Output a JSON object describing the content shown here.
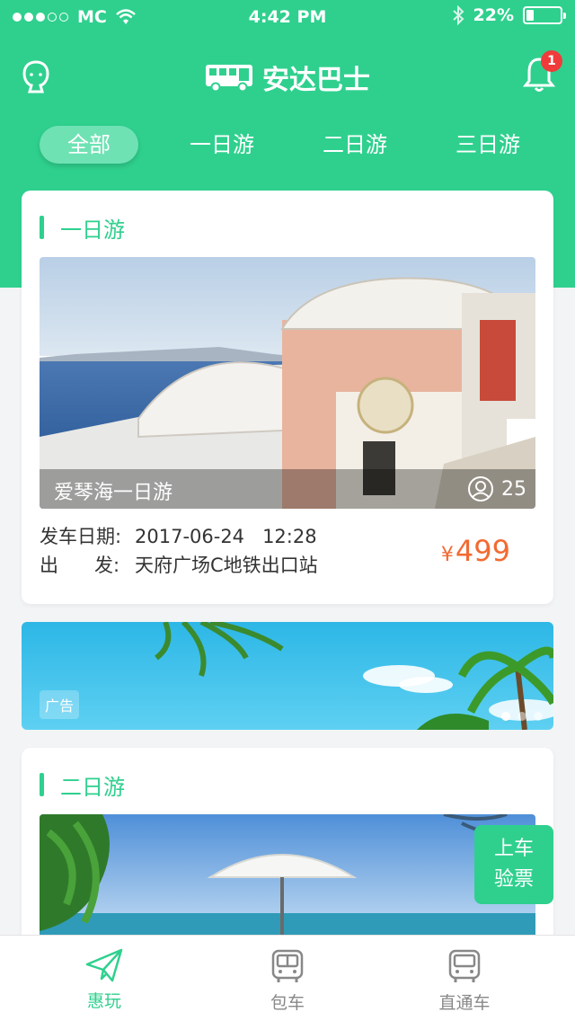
{
  "status_bar": {
    "carrier": "MC",
    "time": "4:42 PM",
    "battery": "22%",
    "battery_level": 0.22
  },
  "header": {
    "title": "安达巴士",
    "notification_count": "1"
  },
  "tabs": [
    {
      "label": "全部",
      "active": true
    },
    {
      "label": "一日游",
      "active": false
    },
    {
      "label": "二日游",
      "active": false
    },
    {
      "label": "三日游",
      "active": false
    }
  ],
  "trips": [
    {
      "section_title": "一日游",
      "trip_name": "爱琴海一日游",
      "passenger_count": "25",
      "date_label": "发车日期:",
      "date_value": "2017-06-24   12:28",
      "depart_label": "出      发:",
      "depart_value": "天府广场C地铁出口站",
      "currency": "¥",
      "price": "499"
    },
    {
      "section_title": "二日游"
    }
  ],
  "ad": {
    "tag": "广告",
    "dots_total": 3,
    "dots_active": 1
  },
  "check_button": {
    "line1": "上车",
    "line2": "验票"
  },
  "bottom_nav": [
    {
      "label": "惠玩",
      "icon": "paper-plane-icon",
      "active": true
    },
    {
      "label": "包车",
      "icon": "bus-icon",
      "active": false
    },
    {
      "label": "直通车",
      "icon": "bus-icon",
      "active": false
    }
  ],
  "colors": {
    "brand": "#2fd08e",
    "price": "#f26a32",
    "badge": "#f03b3b"
  }
}
